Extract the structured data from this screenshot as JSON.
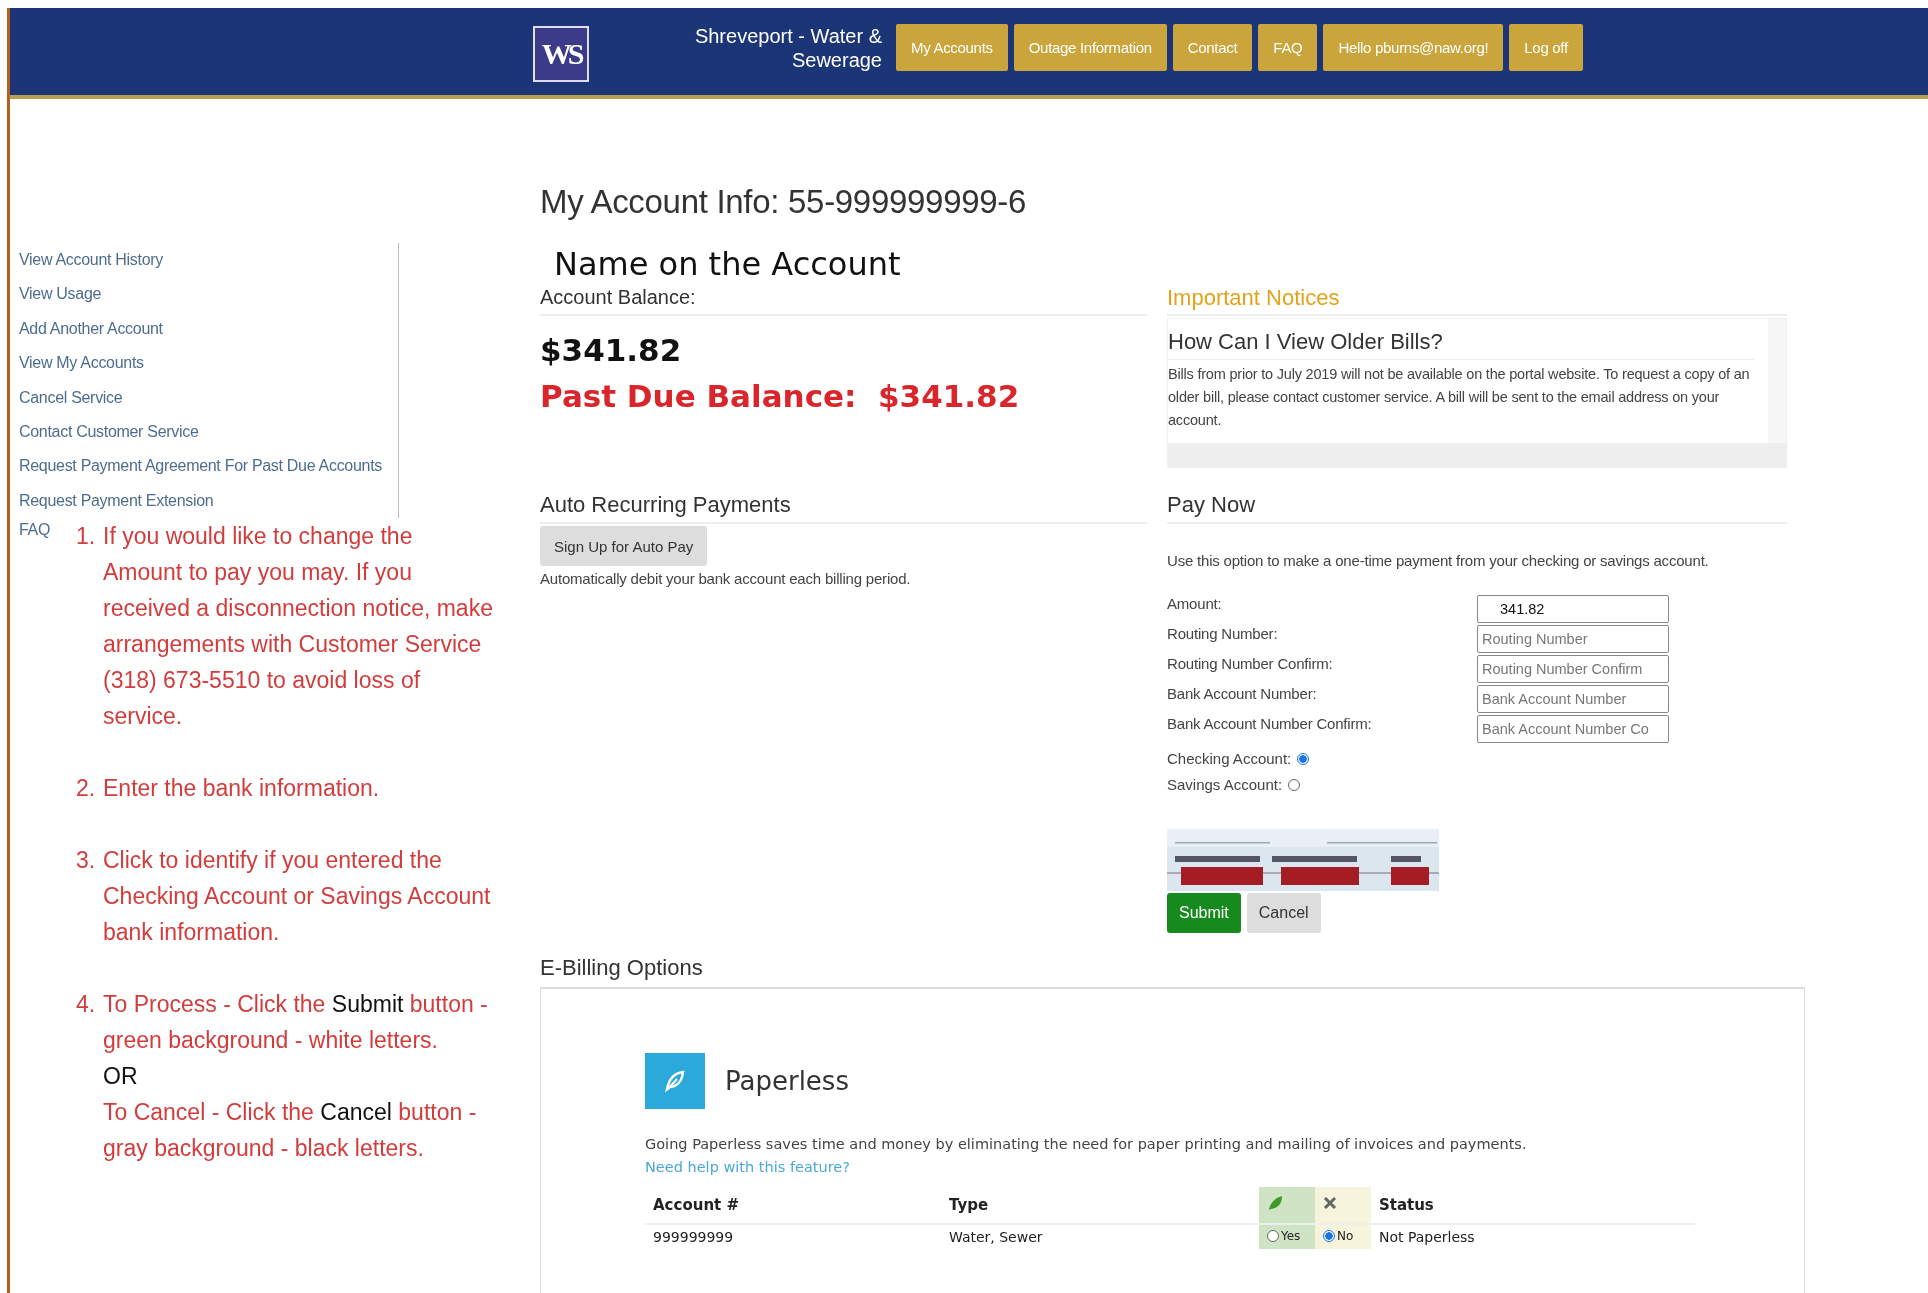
{
  "header": {
    "logo": "WS",
    "title": "Shreveport - Water & Sewerage",
    "nav": [
      "My Accounts",
      "Outage Information",
      "Contact",
      "FAQ",
      "Hello pburns@naw.org!",
      "Log off"
    ]
  },
  "sidebar": {
    "links": [
      "View Account History",
      "View Usage",
      "Add Another Account",
      "View My Accounts",
      "Cancel Service",
      "Contact Customer Service",
      "Request Payment Agreement For Past Due Accounts",
      "Request Payment Extension",
      "FAQ"
    ]
  },
  "notes": [
    {
      "number": "1.",
      "paragraphs": [
        [
          {
            "text": "If you would like to change the Amount to pay you may.  If you received a disconnection notice, make arrangements with Customer Service (318) 673-5510 to avoid loss of service.",
            "kind": "note"
          }
        ]
      ]
    },
    {
      "number": "2.",
      "paragraphs": [
        [
          {
            "text": "Enter the bank information.",
            "kind": "note"
          }
        ]
      ]
    },
    {
      "number": "3.",
      "paragraphs": [
        [
          {
            "text": "Click to identify if you entered the Checking Account or Savings Account bank information.",
            "kind": "note"
          }
        ]
      ]
    },
    {
      "number": "4.",
      "paragraphs": [
        [
          {
            "text": "To Process  - Click the ",
            "kind": "note"
          },
          {
            "text": "Submit",
            "kind": "plain"
          },
          {
            "text": " button - green background - white letters.",
            "kind": "note"
          }
        ],
        [
          {
            "text": "OR",
            "kind": "plain"
          }
        ],
        [
          {
            "text": "To Cancel - Click the ",
            "kind": "note"
          },
          {
            "text": "Cancel",
            "kind": "plain"
          },
          {
            "text": " button - gray background - black letters.",
            "kind": "note"
          }
        ]
      ]
    }
  ],
  "account": {
    "title": "My Account Info: 55-999999999-6",
    "name": "Name on the Account",
    "balance_label": "Account Balance:",
    "balance": "$341.82",
    "past_due": "Past Due Balance:  $341.82"
  },
  "notices": {
    "title": "Important Notices",
    "items": [
      {
        "heading": "How Can I View Older Bills?",
        "body": "Bills from prior to July 2019 will not be available on the portal website. To request a copy of an older bill, please contact customer service. A bill will be sent to the email address on your account."
      }
    ]
  },
  "autopay": {
    "title": "Auto Recurring Payments",
    "button": "Sign Up for Auto Pay",
    "description": "Automatically debit your bank account each billing period."
  },
  "pay_now": {
    "title": "Pay Now",
    "description": "Use this option to make a one-time payment from your checking or savings account.",
    "fields": [
      {
        "label": "Amount:",
        "value": "341.82"
      },
      {
        "label": "Routing Number:",
        "placeholder": "Routing Number"
      },
      {
        "label": "Routing Number Confirm:",
        "placeholder": "Routing Number Confirm"
      },
      {
        "label": "Bank Account Number:",
        "placeholder": "Bank Account Number"
      },
      {
        "label": "Bank Account Number Confirm:",
        "placeholder": "Bank Account Number Co"
      }
    ],
    "account_types": [
      {
        "label": "Checking Account:",
        "selected": true
      },
      {
        "label": "Savings Account:",
        "selected": false
      }
    ],
    "buttons": [
      {
        "label": "Submit",
        "kind": "primary"
      },
      {
        "label": "Cancel",
        "kind": "secondary"
      }
    ]
  },
  "ebilling": {
    "title": "E-Billing Options",
    "paperless": {
      "title": "Paperless",
      "description": "Going Paperless saves time and money by eliminating the need for paper printing and mailing of invoices and payments.",
      "help_link": "Need help with this feature?"
    },
    "table": {
      "columns": [
        {
          "kind": "text",
          "label": "Account #"
        },
        {
          "kind": "text",
          "label": "Type"
        },
        {
          "kind": "leaf"
        },
        {
          "kind": "cross"
        },
        {
          "kind": "text",
          "label": "Status"
        }
      ],
      "rows": [
        {
          "account": "999999999",
          "type": "Water, Sewer",
          "options": [
            {
              "label": "Yes",
              "selected": false
            },
            {
              "label": "No",
              "selected": true
            }
          ],
          "status": "Not Paperless"
        }
      ]
    }
  }
}
